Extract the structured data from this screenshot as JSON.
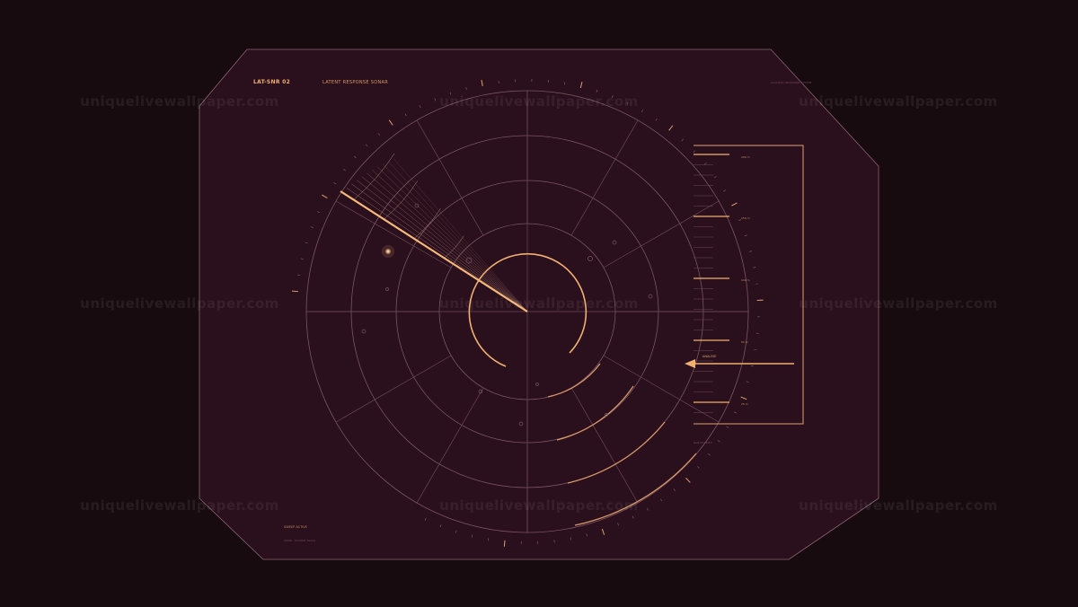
{
  "header": {
    "title": "LAT-SNR 02",
    "subtitle": "LATENT RESPONSE SONAR",
    "corner_right": "ACOUSTIC RESPONSE SYSTEM"
  },
  "scale": {
    "labels": [
      "200 m",
      "150 m",
      "100 m",
      "50 m",
      "25 m"
    ],
    "footer": "RANGE INDEX"
  },
  "target": {
    "label": "ANALYSE"
  },
  "footer": {
    "line1": "SWEEP ACTIVE",
    "line2": "MODE - PASSIVE TRACK"
  },
  "watermark": {
    "text": "uniquelivewallpaper.com"
  },
  "colors": {
    "background": "#170b10",
    "panel": "#2a0f1d",
    "accent": "#f0b070",
    "grid": "#7a5560"
  }
}
